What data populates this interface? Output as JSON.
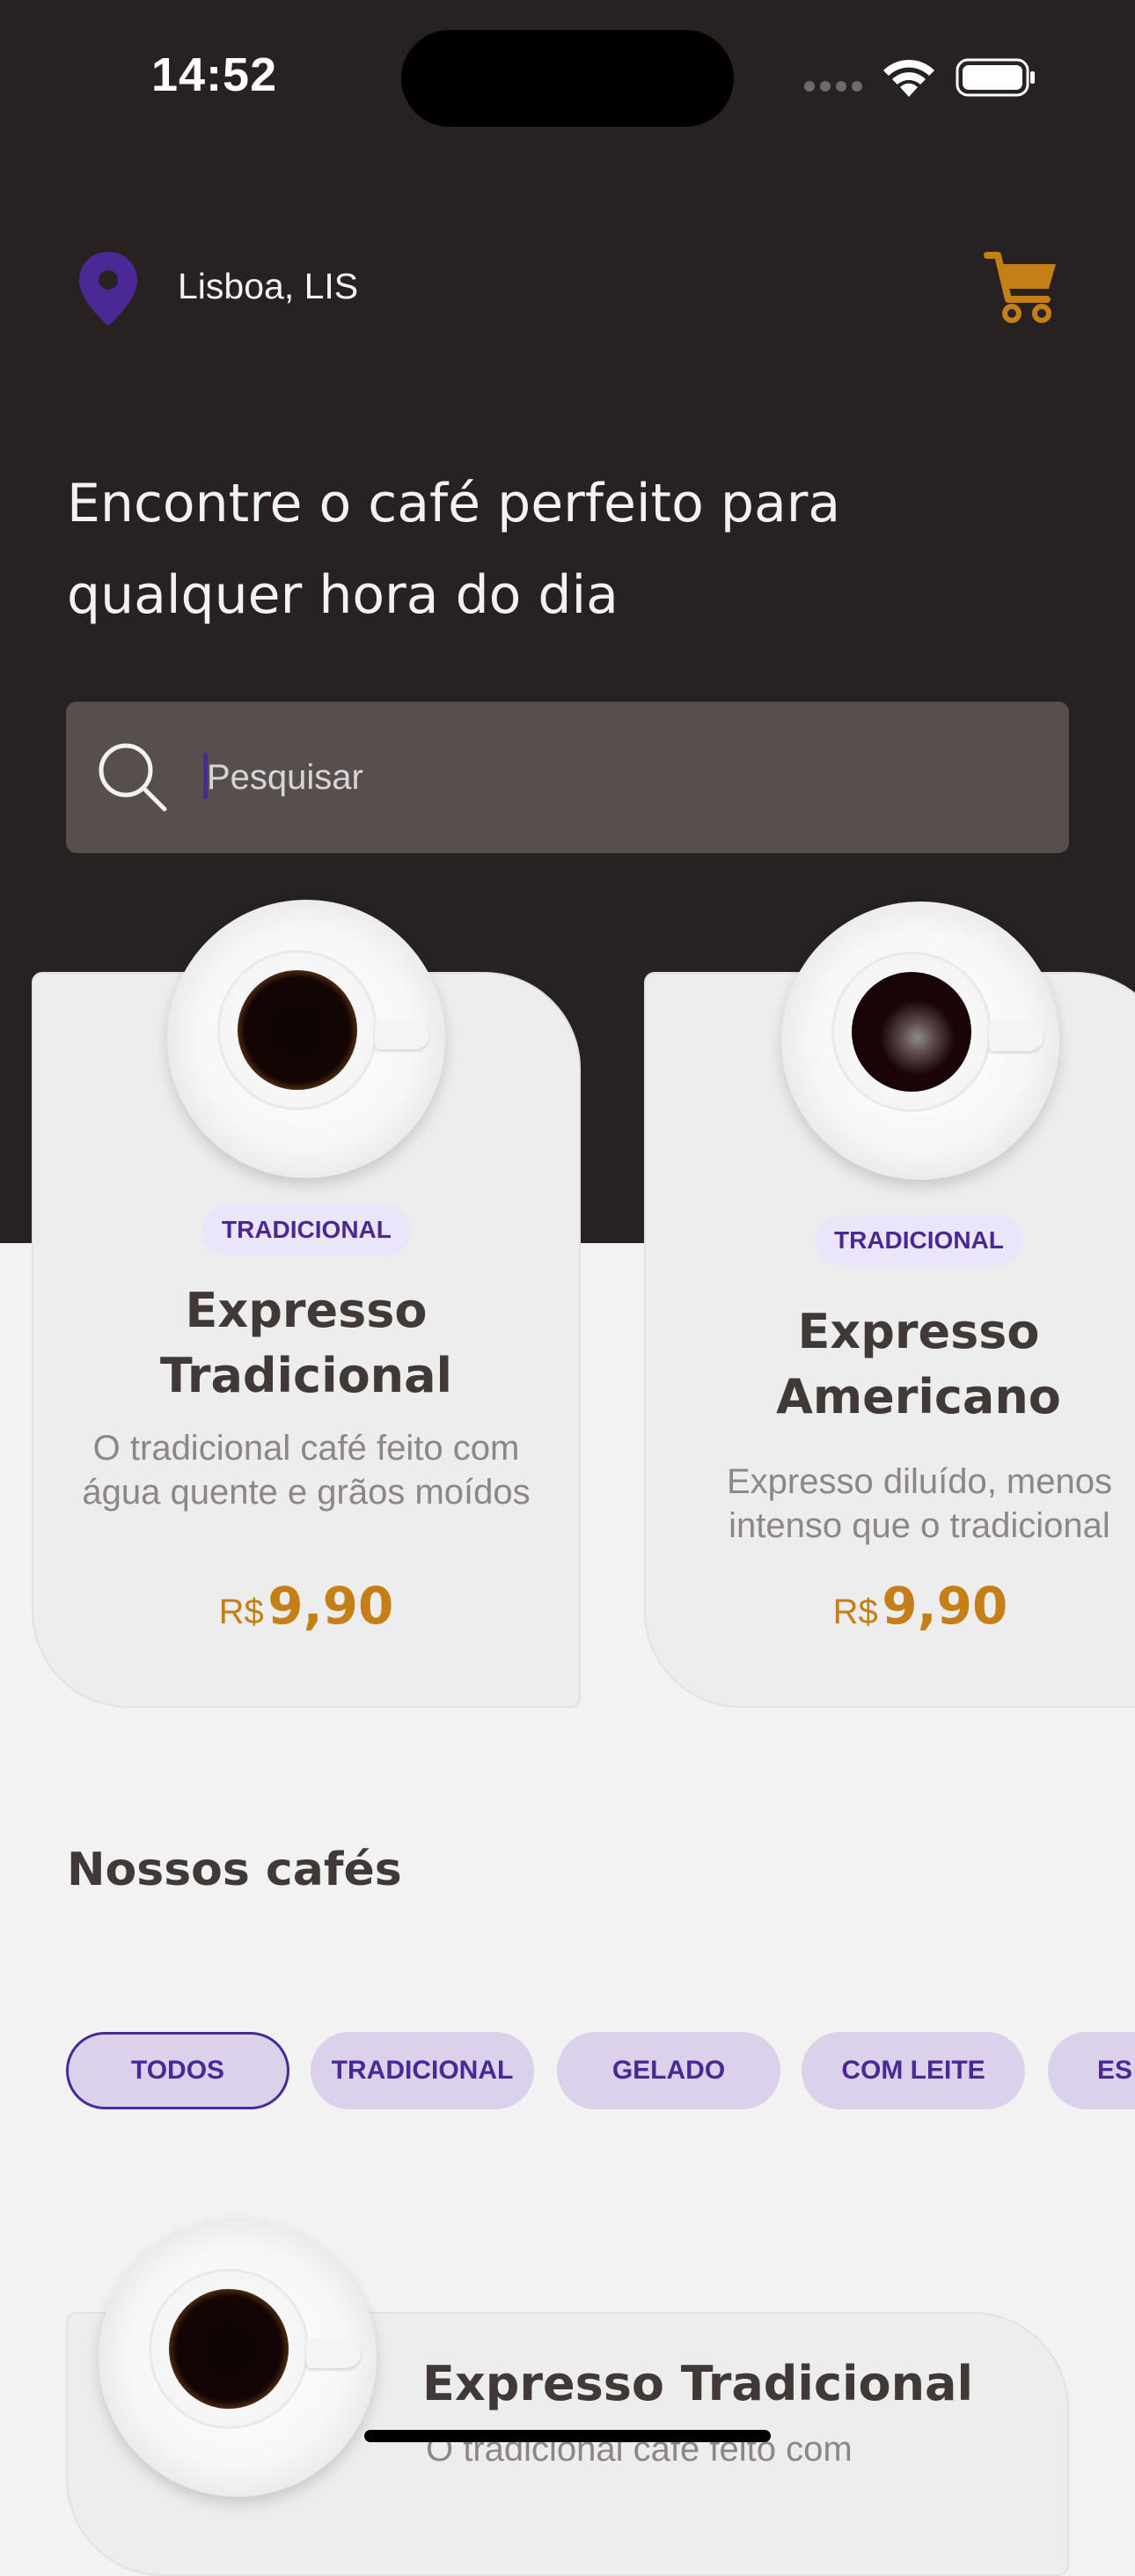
{
  "status_bar": {
    "time": "14:52"
  },
  "header": {
    "location": "Lisboa, LIS"
  },
  "intro": {
    "headline": "Encontre o café perfeito para qualquer hora do dia"
  },
  "search": {
    "placeholder": "Pesquisar"
  },
  "featured": [
    {
      "tag": "Tradicional",
      "title": "Expresso Tradicional",
      "description": "O tradicional café feito com água quente e grãos moídos",
      "currency": "R$",
      "price": "9,90"
    },
    {
      "tag": "Tradicional",
      "title": "Expresso Americano",
      "description": "Expresso diluído, menos intenso que o tradicional",
      "currency": "R$",
      "price": "9,90"
    }
  ],
  "section": {
    "title": "Nossos cafés"
  },
  "filters": [
    {
      "label": "Todos",
      "active": true
    },
    {
      "label": "Tradicional",
      "active": false
    },
    {
      "label": "Gelado",
      "active": false
    },
    {
      "label": "Com leite",
      "active": false
    },
    {
      "label": "Es",
      "active": false
    }
  ],
  "list": [
    {
      "title": "Expresso Tradicional",
      "description": "O tradicional café feito com"
    }
  ],
  "colors": {
    "dark": "#272221",
    "purple": "#4B2995",
    "purple_light": "#DCD1EA",
    "yellow": "#C47F17",
    "yellow_dark": "#DBAC2C"
  }
}
